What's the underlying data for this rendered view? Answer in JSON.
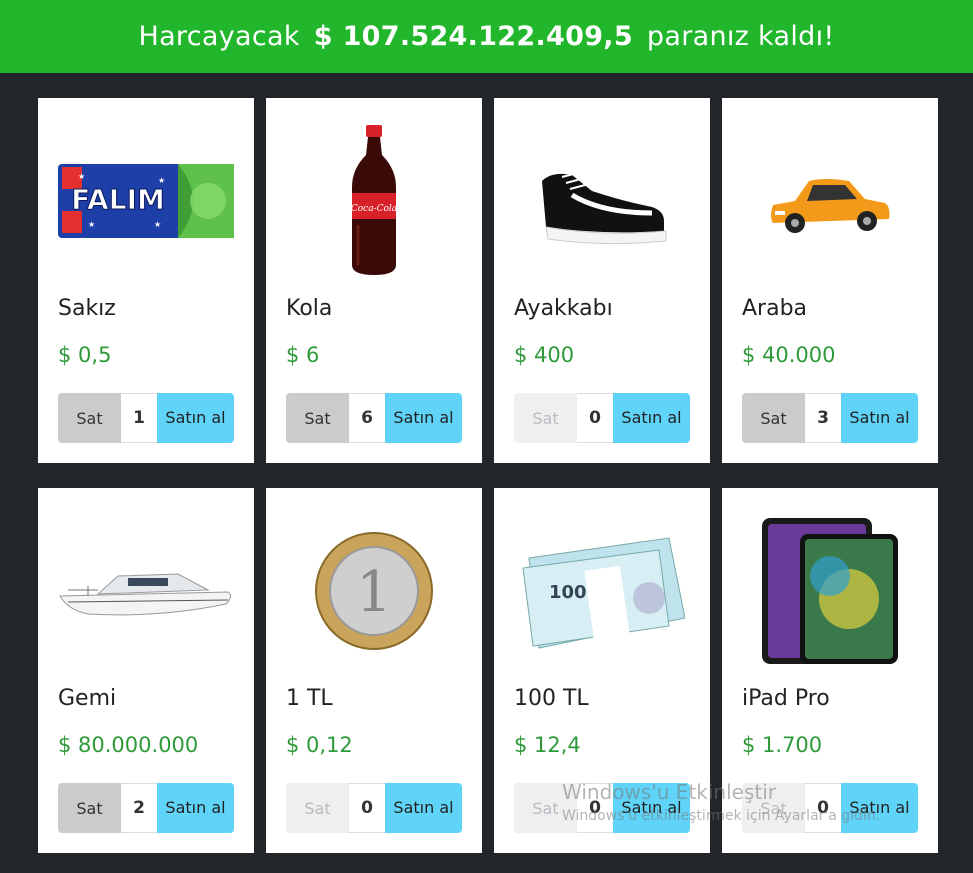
{
  "header": {
    "prefix": "Harcayacak",
    "amount": "$ 107.524.122.409,5",
    "suffix": "paranız kaldı!"
  },
  "colors": {
    "header_bg": "#21b62b",
    "price": "#2e9a3a",
    "buy_button": "#5fd4f8",
    "sell_button": "#c9cbcd"
  },
  "products": [
    {
      "name": "Sakız",
      "price": "$ 0,5",
      "sell_label": "Sat",
      "qty": "1",
      "buy_label": "Satın al",
      "icon": "chewing-gum-icon",
      "sell_enabled": true
    },
    {
      "name": "Kola",
      "price": "$ 6",
      "sell_label": "Sat",
      "qty": "6",
      "buy_label": "Satın al",
      "icon": "cola-bottle-icon",
      "sell_enabled": true
    },
    {
      "name": "Ayakkabı",
      "price": "$ 400",
      "sell_label": "Sat",
      "qty": "0",
      "buy_label": "Satın al",
      "icon": "sneaker-icon",
      "sell_enabled": false
    },
    {
      "name": "Araba",
      "price": "$ 40.000",
      "sell_label": "Sat",
      "qty": "3",
      "buy_label": "Satın al",
      "icon": "car-icon",
      "sell_enabled": true
    },
    {
      "name": "Gemi",
      "price": "$ 80.000.000",
      "sell_label": "Sat",
      "qty": "2",
      "buy_label": "Satın al",
      "icon": "yacht-icon",
      "sell_enabled": true
    },
    {
      "name": "1 TL",
      "price": "$ 0,12",
      "sell_label": "Sat",
      "qty": "0",
      "buy_label": "Satın al",
      "icon": "coin-icon",
      "sell_enabled": false
    },
    {
      "name": "100 TL",
      "price": "$ 12,4",
      "sell_label": "Sat",
      "qty": "0",
      "buy_label": "Satın al",
      "icon": "banknotes-icon",
      "sell_enabled": false
    },
    {
      "name": "iPad Pro",
      "price": "$ 1.700",
      "sell_label": "Sat",
      "qty": "0",
      "buy_label": "Satın al",
      "icon": "tablet-icon",
      "sell_enabled": false
    }
  ],
  "watermark": {
    "line1": "Windows'u Etkinleştir",
    "line2": "Windows'u etkinleştirmek için Ayarlar'a gidin."
  }
}
